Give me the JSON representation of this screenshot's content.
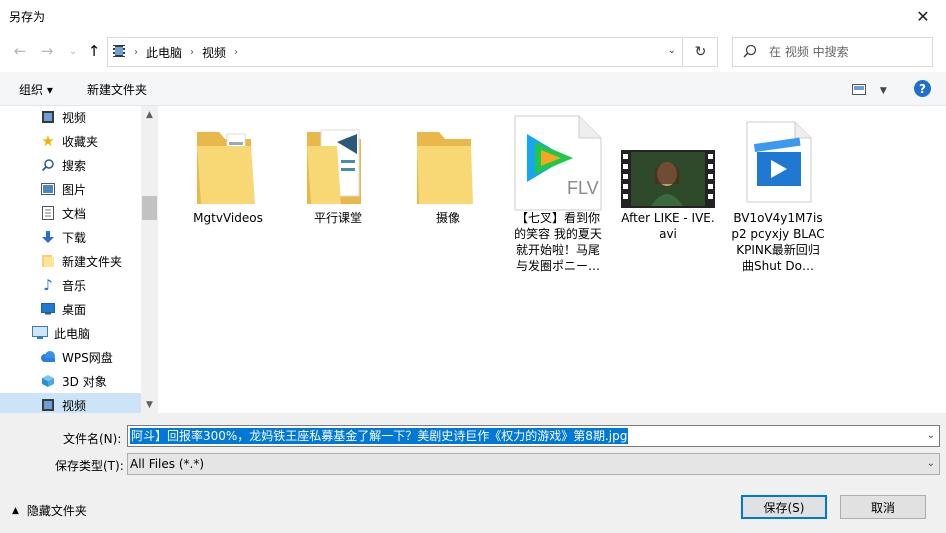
{
  "window": {
    "title": "另存为"
  },
  "nav": {
    "back_icon": "arrow-left-icon",
    "forward_icon": "arrow-right-icon",
    "up_icon": "arrow-up-icon",
    "breadcrumbs": [
      "此电脑",
      "视频"
    ],
    "search_placeholder": "在 视频 中搜索"
  },
  "toolbar": {
    "organize": "组织 ▾",
    "new_folder": "新建文件夹",
    "help": "?"
  },
  "sidebar": {
    "items": [
      {
        "label": "视频",
        "icon": "video-icon"
      },
      {
        "label": "收藏夹",
        "icon": "star-icon"
      },
      {
        "label": "搜索",
        "icon": "search-icon"
      },
      {
        "label": "图片",
        "icon": "picture-icon"
      },
      {
        "label": "文档",
        "icon": "document-icon"
      },
      {
        "label": "下载",
        "icon": "download-icon"
      },
      {
        "label": "新建文件夹",
        "icon": "folder-icon"
      },
      {
        "label": "音乐",
        "icon": "music-icon"
      },
      {
        "label": "桌面",
        "icon": "desktop-icon"
      },
      {
        "label": "此电脑",
        "icon": "computer-icon"
      },
      {
        "label": "WPS网盘",
        "icon": "cloud-icon"
      },
      {
        "label": "3D 对象",
        "icon": "cube-icon"
      },
      {
        "label": "视频",
        "icon": "video-icon"
      }
    ]
  },
  "files": [
    {
      "name": "MgtvVideos",
      "type": "folder"
    },
    {
      "name": "平行课堂",
      "type": "folder"
    },
    {
      "name": "摄像",
      "type": "folder"
    },
    {
      "name": "【七叉】看到你的笑容 我的夏天就开始啦！马尾与发圈ポニー…",
      "type": "flv",
      "badge": "FLV"
    },
    {
      "name": "After LIKE - IVE.avi",
      "type": "video"
    },
    {
      "name": "BV1oV4y1M7isp2 pcyxjy BLACKPINK最新回归曲Shut Do…",
      "type": "video-file"
    }
  ],
  "form": {
    "filename_label": "文件名(N):",
    "filename_value": "阿斗】回报率300%，龙妈铁王座私募基金了解一下？美剧史诗巨作《权力的游戏》第8期.jpg",
    "filetype_label": "保存类型(T):",
    "filetype_value": "All Files (*.*)",
    "hide_folders": "隐藏文件夹",
    "save": "保存(S)",
    "cancel": "取消"
  }
}
